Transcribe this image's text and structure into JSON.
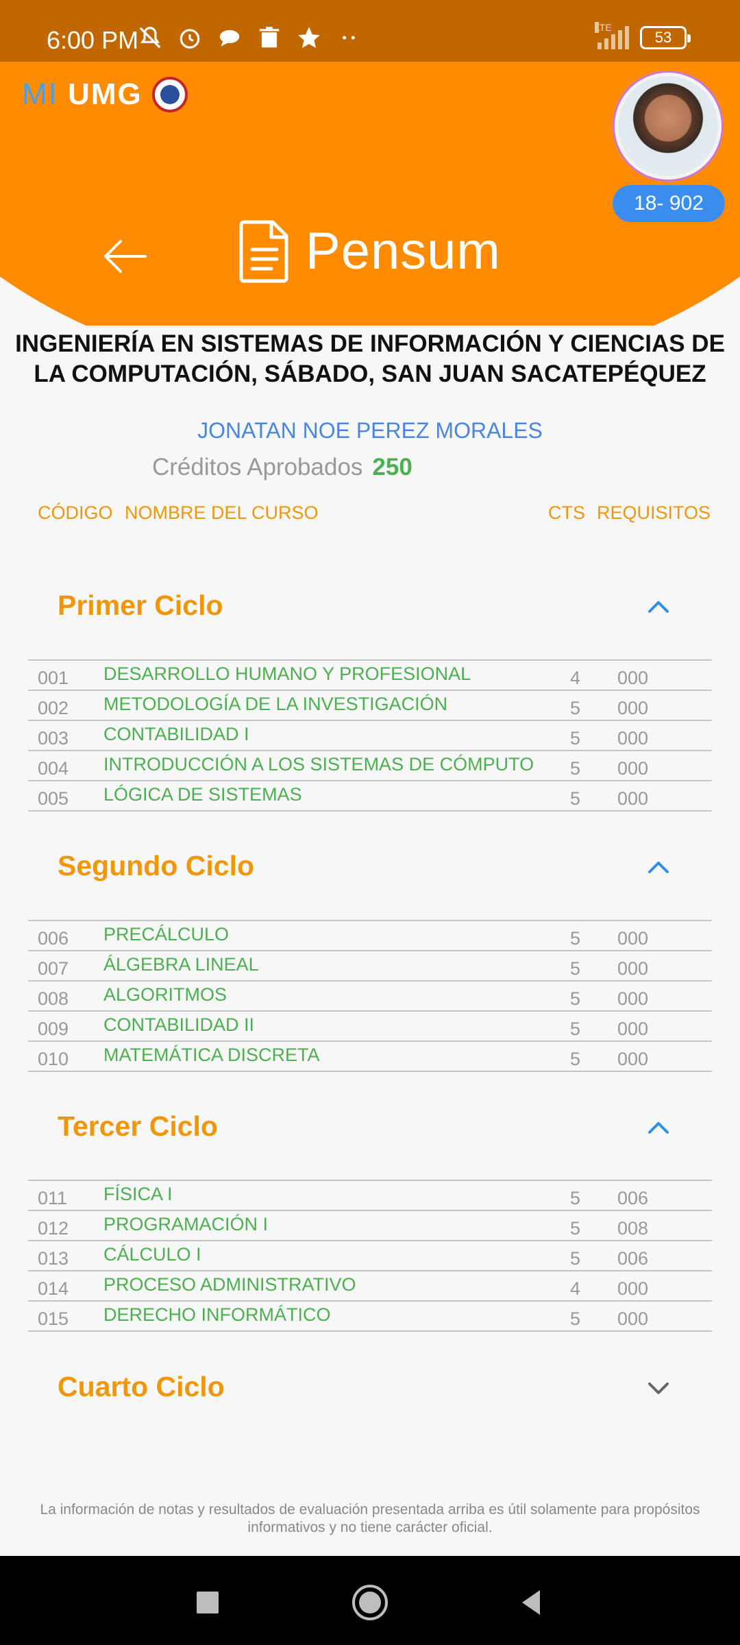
{
  "status_bar": {
    "time": "6:00 PM",
    "network": "LTE",
    "battery": "53",
    "icons": [
      "mute-icon",
      "alarm-icon",
      "chat-bubble-icon",
      "trash-icon",
      "star-icon",
      "more-dots-icon"
    ]
  },
  "header": {
    "logo_mi": "MI",
    "logo_umg": "UMG",
    "student_id": "18- 902",
    "title": "Pensum"
  },
  "career": {
    "name": "INGENIERÍA EN SISTEMAS DE INFORMACIÓN Y CIENCIAS DE LA COMPUTACIÓN, SÁBADO, SAN JUAN SACATEPÉQUEZ",
    "student_name": "JONATAN NOE PEREZ MORALES",
    "credits_label": "Créditos Aprobados",
    "credits_value": "250"
  },
  "columns": {
    "code": "CÓDIGO",
    "name": "NOMBRE DEL CURSO",
    "cts": "CTS",
    "req": "REQUISITOS"
  },
  "cycles": [
    {
      "title": "Primer Ciclo",
      "expanded": true,
      "courses": [
        {
          "code": "001",
          "name": "DESARROLLO HUMANO Y PROFESIONAL",
          "cts": "4",
          "req": "000"
        },
        {
          "code": "002",
          "name": "METODOLOGÍA DE LA INVESTIGACIÓN",
          "cts": "5",
          "req": "000"
        },
        {
          "code": "003",
          "name": "CONTABILIDAD I",
          "cts": "5",
          "req": "000"
        },
        {
          "code": "004",
          "name": "INTRODUCCIÓN A LOS SISTEMAS DE CÓMPUTO",
          "cts": "5",
          "req": "000"
        },
        {
          "code": "005",
          "name": "LÓGICA DE SISTEMAS",
          "cts": "5",
          "req": "000"
        }
      ]
    },
    {
      "title": "Segundo Ciclo",
      "expanded": true,
      "courses": [
        {
          "code": "006",
          "name": "PRECÁLCULO",
          "cts": "5",
          "req": "000"
        },
        {
          "code": "007",
          "name": "ÁLGEBRA LINEAL",
          "cts": "5",
          "req": "000"
        },
        {
          "code": "008",
          "name": "ALGORITMOS",
          "cts": "5",
          "req": "000"
        },
        {
          "code": "009",
          "name": "CONTABILIDAD II",
          "cts": "5",
          "req": "000"
        },
        {
          "code": "010",
          "name": "MATEMÁTICA DISCRETA",
          "cts": "5",
          "req": "000"
        }
      ]
    },
    {
      "title": "Tercer Ciclo",
      "expanded": true,
      "courses": [
        {
          "code": "011",
          "name": "FÍSICA I",
          "cts": "5",
          "req": "006"
        },
        {
          "code": "012",
          "name": "PROGRAMACIÓN I",
          "cts": "5",
          "req": "008"
        },
        {
          "code": "013",
          "name": "CÁLCULO I",
          "cts": "5",
          "req": "006"
        },
        {
          "code": "014",
          "name": "PROCESO ADMINISTRATIVO",
          "cts": "4",
          "req": "000"
        },
        {
          "code": "015",
          "name": "DERECHO INFORMÁTICO",
          "cts": "5",
          "req": "000"
        }
      ]
    },
    {
      "title": "Cuarto Ciclo",
      "expanded": false,
      "courses": []
    }
  ],
  "disclaimer": "La información de notas y resultados de evaluación presentada arriba es útil solamente para propósitos informativos y no tiene carácter oficial.",
  "colors": {
    "header_orange": "#ff8c00",
    "status_bar": "#c06700",
    "cycle_title": "#f0960a",
    "course_green": "#4caf50",
    "student_name_blue": "#4a86e0",
    "id_badge_blue": "#3b8ef0"
  }
}
